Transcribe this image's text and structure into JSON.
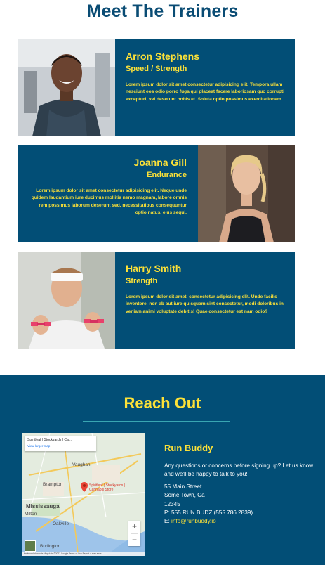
{
  "trainers_section": {
    "heading": "Meet The Trainers",
    "trainers": [
      {
        "name": "Arron Stephens",
        "role": "Speed / Strength",
        "bio": "Lorem ipsum dolor sit amet consectetur adipisicing elit. Tempora ullam nesciunt eos odio porro fuga qui placeat facere laboriosam quo corrupti excepturi, vel deserunt nobis et. Soluta optio possimus exercitationem."
      },
      {
        "name": "Joanna Gill",
        "role": "Endurance",
        "bio": "Lorem ipsum dolor sit amet consectetur adipisicing elit. Neque unde quidem laudantium iure ducimus mollitia nemo magnam, labore omnis rem possimus laborum deserunt sed, necessitatibus consequuntur optio natus, eius sequi."
      },
      {
        "name": "Harry Smith",
        "role": "Strength",
        "bio": "Lorem ipsum dolor sit amet, consectetur adipisicing elit. Unde facilis inventore, non ab aut iure quisquam sint consectetur, modi doloribus in veniam animi voluptate debitis! Quae consectetur est nam odio?"
      }
    ]
  },
  "contact_section": {
    "heading": "Reach Out",
    "map": {
      "place_title": "Spiritleaf | Stockyards | Ca...",
      "view_larger": "View larger map",
      "pin_label": "Spiritleaf | Stockyards | Cannabis Store",
      "places": [
        "Brampton",
        "Vaughan",
        "Mississauga",
        "Milton",
        "Oakville",
        "Burlington"
      ],
      "zoom_in": "+",
      "zoom_out": "−",
      "footer": "Keyboard shortcuts   Map data ©2022 Google   Terms of Use   Report a map error"
    },
    "company": "Run Buddy",
    "message": "Any questions or concerns before signing up? Let us know and we'll be happy to talk to you!",
    "address_line1": "55 Main Street",
    "address_line2": "Some Town, Ca",
    "zip": "12345",
    "phone": "P: 555.RUN.BUDZ (555.786.2839)",
    "email_prefix": "E: ",
    "email": "info@runbuddy.io"
  },
  "colors": {
    "primary_blue": "#024e76",
    "accent_yellow": "#fce138",
    "rule_teal": "#39a6b2"
  }
}
